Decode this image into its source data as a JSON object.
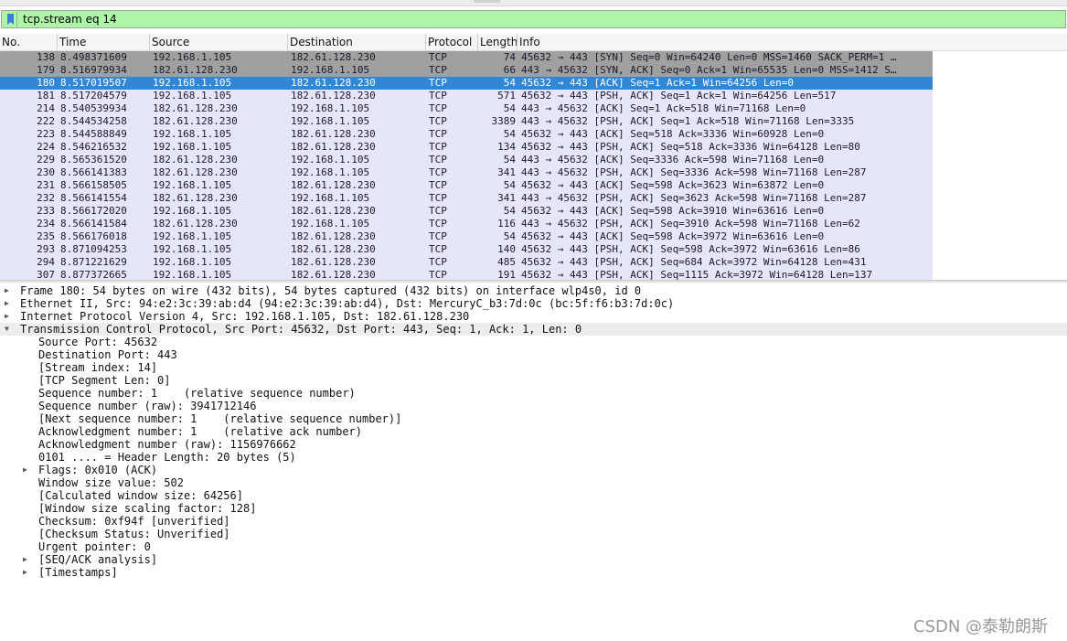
{
  "filter": {
    "text": "tcp.stream eq 14",
    "background": "#aff5a8"
  },
  "columns": [
    "No.",
    "Time",
    "Source",
    "Destination",
    "Protocol",
    "Length",
    "Info"
  ],
  "packets": [
    {
      "no": "138",
      "time": "8.498371609",
      "src": "192.168.1.105",
      "dst": "182.61.128.230",
      "proto": "TCP",
      "len": "74",
      "info": "45632 → 443 [SYN] Seq=0 Win=64240 Len=0 MSS=1460 SACK_PERM=1 …",
      "kind": "syn"
    },
    {
      "no": "179",
      "time": "8.516979934",
      "src": "182.61.128.230",
      "dst": "192.168.1.105",
      "proto": "TCP",
      "len": "66",
      "info": "443 → 45632 [SYN, ACK] Seq=0 Ack=1 Win=65535 Len=0 MSS=1412 S…",
      "kind": "syn"
    },
    {
      "no": "180",
      "time": "8.517019507",
      "src": "192.168.1.105",
      "dst": "182.61.128.230",
      "proto": "TCP",
      "len": "54",
      "info": "45632 → 443 [ACK] Seq=1 Ack=1 Win=64256 Len=0",
      "kind": "sel"
    },
    {
      "no": "181",
      "time": "8.517204579",
      "src": "192.168.1.105",
      "dst": "182.61.128.230",
      "proto": "TCP",
      "len": "571",
      "info": "45632 → 443 [PSH, ACK] Seq=1 Ack=1 Win=64256 Len=517",
      "kind": "normal"
    },
    {
      "no": "214",
      "time": "8.540539934",
      "src": "182.61.128.230",
      "dst": "192.168.1.105",
      "proto": "TCP",
      "len": "54",
      "info": "443 → 45632 [ACK] Seq=1 Ack=518 Win=71168 Len=0",
      "kind": "normal"
    },
    {
      "no": "222",
      "time": "8.544534258",
      "src": "182.61.128.230",
      "dst": "192.168.1.105",
      "proto": "TCP",
      "len": "3389",
      "info": "443 → 45632 [PSH, ACK] Seq=1 Ack=518 Win=71168 Len=3335",
      "kind": "normal"
    },
    {
      "no": "223",
      "time": "8.544588849",
      "src": "192.168.1.105",
      "dst": "182.61.128.230",
      "proto": "TCP",
      "len": "54",
      "info": "45632 → 443 [ACK] Seq=518 Ack=3336 Win=60928 Len=0",
      "kind": "normal"
    },
    {
      "no": "224",
      "time": "8.546216532",
      "src": "192.168.1.105",
      "dst": "182.61.128.230",
      "proto": "TCP",
      "len": "134",
      "info": "45632 → 443 [PSH, ACK] Seq=518 Ack=3336 Win=64128 Len=80",
      "kind": "normal"
    },
    {
      "no": "229",
      "time": "8.565361520",
      "src": "182.61.128.230",
      "dst": "192.168.1.105",
      "proto": "TCP",
      "len": "54",
      "info": "443 → 45632 [ACK] Seq=3336 Ack=598 Win=71168 Len=0",
      "kind": "normal"
    },
    {
      "no": "230",
      "time": "8.566141383",
      "src": "182.61.128.230",
      "dst": "192.168.1.105",
      "proto": "TCP",
      "len": "341",
      "info": "443 → 45632 [PSH, ACK] Seq=3336 Ack=598 Win=71168 Len=287",
      "kind": "normal"
    },
    {
      "no": "231",
      "time": "8.566158505",
      "src": "192.168.1.105",
      "dst": "182.61.128.230",
      "proto": "TCP",
      "len": "54",
      "info": "45632 → 443 [ACK] Seq=598 Ack=3623 Win=63872 Len=0",
      "kind": "normal"
    },
    {
      "no": "232",
      "time": "8.566141554",
      "src": "182.61.128.230",
      "dst": "192.168.1.105",
      "proto": "TCP",
      "len": "341",
      "info": "443 → 45632 [PSH, ACK] Seq=3623 Ack=598 Win=71168 Len=287",
      "kind": "normal"
    },
    {
      "no": "233",
      "time": "8.566172020",
      "src": "192.168.1.105",
      "dst": "182.61.128.230",
      "proto": "TCP",
      "len": "54",
      "info": "45632 → 443 [ACK] Seq=598 Ack=3910 Win=63616 Len=0",
      "kind": "normal"
    },
    {
      "no": "234",
      "time": "8.566141584",
      "src": "182.61.128.230",
      "dst": "192.168.1.105",
      "proto": "TCP",
      "len": "116",
      "info": "443 → 45632 [PSH, ACK] Seq=3910 Ack=598 Win=71168 Len=62",
      "kind": "normal"
    },
    {
      "no": "235",
      "time": "8.566176018",
      "src": "192.168.1.105",
      "dst": "182.61.128.230",
      "proto": "TCP",
      "len": "54",
      "info": "45632 → 443 [ACK] Seq=598 Ack=3972 Win=63616 Len=0",
      "kind": "normal"
    },
    {
      "no": "293",
      "time": "8.871094253",
      "src": "192.168.1.105",
      "dst": "182.61.128.230",
      "proto": "TCP",
      "len": "140",
      "info": "45632 → 443 [PSH, ACK] Seq=598 Ack=3972 Win=63616 Len=86",
      "kind": "normal"
    },
    {
      "no": "294",
      "time": "8.871221629",
      "src": "192.168.1.105",
      "dst": "182.61.128.230",
      "proto": "TCP",
      "len": "485",
      "info": "45632 → 443 [PSH, ACK] Seq=684 Ack=3972 Win=64128 Len=431",
      "kind": "normal"
    },
    {
      "no": "307",
      "time": "8.877372665",
      "src": "192.168.1.105",
      "dst": "182.61.128.230",
      "proto": "TCP",
      "len": "191",
      "info": "45632 → 443 [PSH, ACK] Seq=1115 Ack=3972 Win=64128 Len=137",
      "kind": "normal"
    }
  ],
  "details": [
    {
      "text": "Frame 180: 54 bytes on wire (432 bits), 54 bytes captured (432 bits) on interface wlp4s0, id 0",
      "level": 0,
      "arrow": "collapsed"
    },
    {
      "text": "Ethernet II, Src: 94:e2:3c:39:ab:d4 (94:e2:3c:39:ab:d4), Dst: MercuryC_b3:7d:0c (bc:5f:f6:b3:7d:0c)",
      "level": 0,
      "arrow": "collapsed"
    },
    {
      "text": "Internet Protocol Version 4, Src: 192.168.1.105, Dst: 182.61.128.230",
      "level": 0,
      "arrow": "collapsed"
    },
    {
      "text": "Transmission Control Protocol, Src Port: 45632, Dst Port: 443, Seq: 1, Ack: 1, Len: 0",
      "level": 0,
      "arrow": "expanded"
    },
    {
      "text": "Source Port: 45632",
      "level": 1,
      "arrow": "none"
    },
    {
      "text": "Destination Port: 443",
      "level": 1,
      "arrow": "none"
    },
    {
      "text": "[Stream index: 14]",
      "level": 1,
      "arrow": "none"
    },
    {
      "text": "[TCP Segment Len: 0]",
      "level": 1,
      "arrow": "none"
    },
    {
      "text": "Sequence number: 1    (relative sequence number)",
      "level": 1,
      "arrow": "none"
    },
    {
      "text": "Sequence number (raw): 3941712146",
      "level": 1,
      "arrow": "none"
    },
    {
      "text": "[Next sequence number: 1    (relative sequence number)]",
      "level": 1,
      "arrow": "none"
    },
    {
      "text": "Acknowledgment number: 1    (relative ack number)",
      "level": 1,
      "arrow": "none"
    },
    {
      "text": "Acknowledgment number (raw): 1156976662",
      "level": 1,
      "arrow": "none"
    },
    {
      "text": "0101 .... = Header Length: 20 bytes (5)",
      "level": 1,
      "arrow": "none"
    },
    {
      "text": "Flags: 0x010 (ACK)",
      "level": 1,
      "arrow": "collapsed"
    },
    {
      "text": "Window size value: 502",
      "level": 1,
      "arrow": "none"
    },
    {
      "text": "[Calculated window size: 64256]",
      "level": 1,
      "arrow": "none"
    },
    {
      "text": "[Window size scaling factor: 128]",
      "level": 1,
      "arrow": "none"
    },
    {
      "text": "Checksum: 0xf94f [unverified]",
      "level": 1,
      "arrow": "none"
    },
    {
      "text": "[Checksum Status: Unverified]",
      "level": 1,
      "arrow": "none"
    },
    {
      "text": "Urgent pointer: 0",
      "level": 1,
      "arrow": "none"
    },
    {
      "text": "[SEQ/ACK analysis]",
      "level": 1,
      "arrow": "collapsed"
    },
    {
      "text": "[Timestamps]",
      "level": 1,
      "arrow": "collapsed"
    }
  ],
  "watermark": "CSDN @泰勒朗斯",
  "colors": {
    "selected_row": "#2f87d6",
    "row_bg": "#e6e6fb",
    "syn_row": "#a0a0a0"
  },
  "icons": {
    "filter_bookmark": "bookmark-icon",
    "collapsed": "triangle-right-icon",
    "expanded": "triangle-down-icon"
  }
}
